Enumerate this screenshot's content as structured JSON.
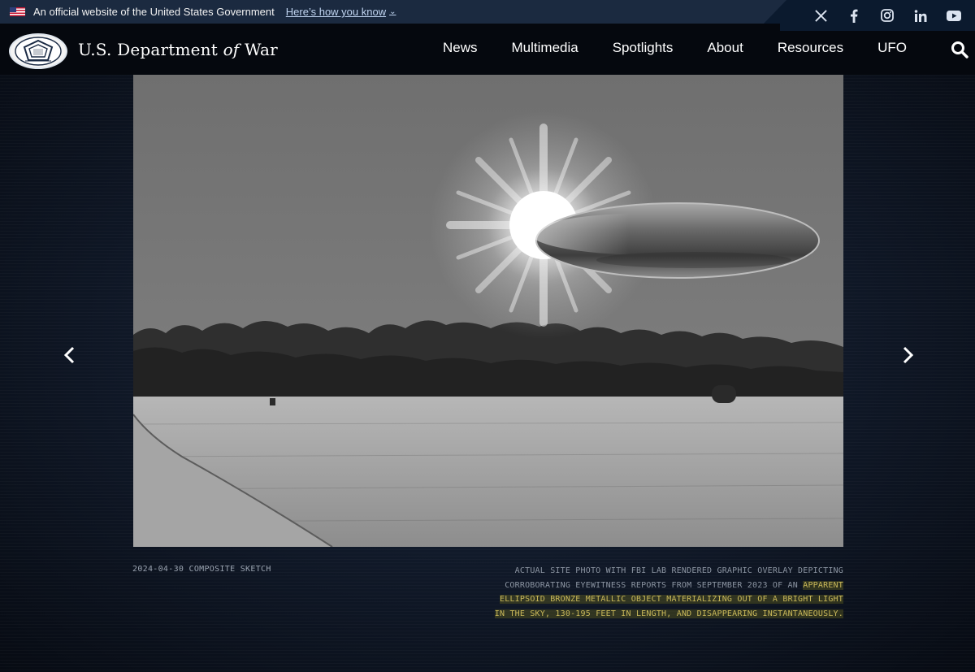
{
  "gov_banner": {
    "text": "An official website of the United States Government",
    "link": "Here’s how you know",
    "chevron": "⌄"
  },
  "social": [
    {
      "icon": "x-icon",
      "glyph": "𝕏"
    },
    {
      "icon": "facebook-icon",
      "glyph": "f"
    },
    {
      "icon": "instagram-icon",
      "glyph": ""
    },
    {
      "icon": "linkedin-icon",
      "glyph": "in"
    },
    {
      "icon": "youtube-icon",
      "glyph": ""
    }
  ],
  "header": {
    "title_pre": "U.S. Department ",
    "title_of": "of",
    "title_post": " War",
    "nav": [
      "News",
      "Multimedia",
      "Spotlights",
      "About",
      "Resources",
      "UFO"
    ]
  },
  "slide": {
    "date_label": "2024-04-30 COMPOSITE SKETCH",
    "caption_plain": "ACTUAL SITE PHOTO WITH FBI LAB RENDERED GRAPHIC OVERLAY DEPICTING CORROBORATING EYEWITNESS REPORTS FROM SEPTEMBER 2023 OF AN",
    "caption_highlight": "APPARENT ELLIPSOID BRONZE METALLIC OBJECT MATERIALIZING OUT OF A BRIGHT LIGHT IN THE SKY, 130-195 FEET IN LENGTH, AND DISAPPEARING INSTANTANEOUSLY."
  },
  "colors": {
    "gov_banner_bg": "#1b2a40",
    "header_bg": "#05080e",
    "stage_bg": "#111a2a",
    "link": "#bfd3ef",
    "highlight_text": "#c9b85a"
  }
}
